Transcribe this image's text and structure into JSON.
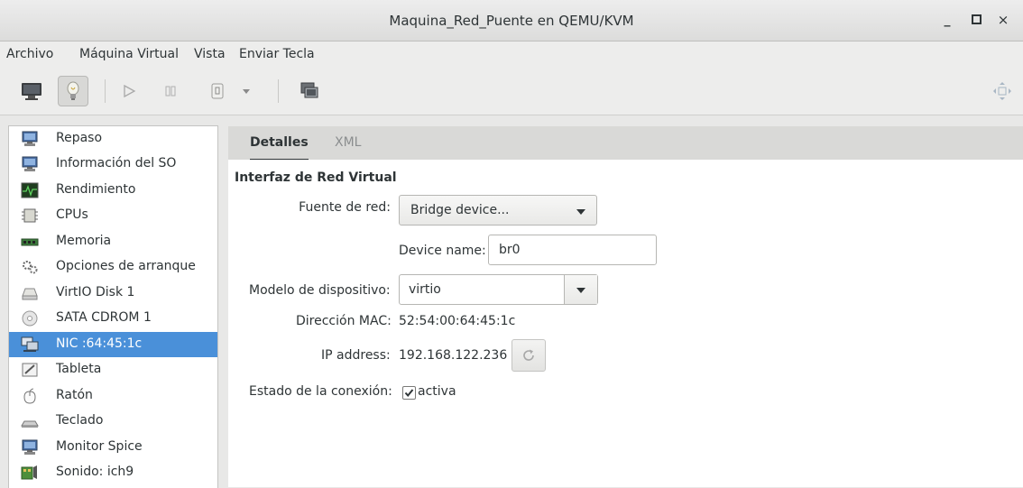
{
  "window": {
    "title": "Maquina_Red_Puente en QEMU/KVM",
    "min_glyph": "_",
    "close_glyph": "×"
  },
  "menu": [
    "Archivo",
    "Máquina Virtual",
    "Vista",
    "Enviar Tecla"
  ],
  "toolbar": {
    "buttons": [
      "monitor-icon",
      "lightbulb-icon",
      "play-icon",
      "pause-icon",
      "power-icon",
      "dropdown-icon",
      "snapshot-icon",
      "fullscreen-icon"
    ]
  },
  "sidebar": {
    "items": [
      {
        "label": "Repaso",
        "icon": "monitor-icon"
      },
      {
        "label": "Información del SO",
        "icon": "monitor-icon"
      },
      {
        "label": "Rendimiento",
        "icon": "graph-icon"
      },
      {
        "label": "CPUs",
        "icon": "chip-icon"
      },
      {
        "label": "Memoria",
        "icon": "memory-icon"
      },
      {
        "label": "Opciones de arranque",
        "icon": "gears-icon"
      },
      {
        "label": "VirtIO Disk 1",
        "icon": "disk-icon"
      },
      {
        "label": "SATA CDROM 1",
        "icon": "cdrom-icon"
      },
      {
        "label": "NIC :64:45:1c",
        "icon": "network-icon",
        "selected": true
      },
      {
        "label": "Tableta",
        "icon": "tablet-icon"
      },
      {
        "label": "Ratón",
        "icon": "mouse-icon"
      },
      {
        "label": "Teclado",
        "icon": "keyboard-icon"
      },
      {
        "label": "Monitor Spice",
        "icon": "monitor-icon"
      },
      {
        "label": "Sonido: ich9",
        "icon": "sound-icon"
      }
    ],
    "selected_color": "#4a90d9"
  },
  "tabs": {
    "details": "Detalles",
    "xml": "XML"
  },
  "details": {
    "section_title": "Interfaz de Red Virtual",
    "network_source_label": "Fuente de red:",
    "network_source_value": "Bridge device...",
    "device_name_label": "Device name:",
    "device_name_value": "br0",
    "device_model_label": "Modelo de dispositivo:",
    "device_model_value": "virtio",
    "mac_label": "Dirección MAC:",
    "mac_value": "52:54:00:64:45:1c",
    "ip_label": "IP address:",
    "ip_value": "192.168.122.236",
    "link_state_label": "Estado de la conexión:",
    "link_state_value": "activa",
    "link_state_checked": true
  }
}
